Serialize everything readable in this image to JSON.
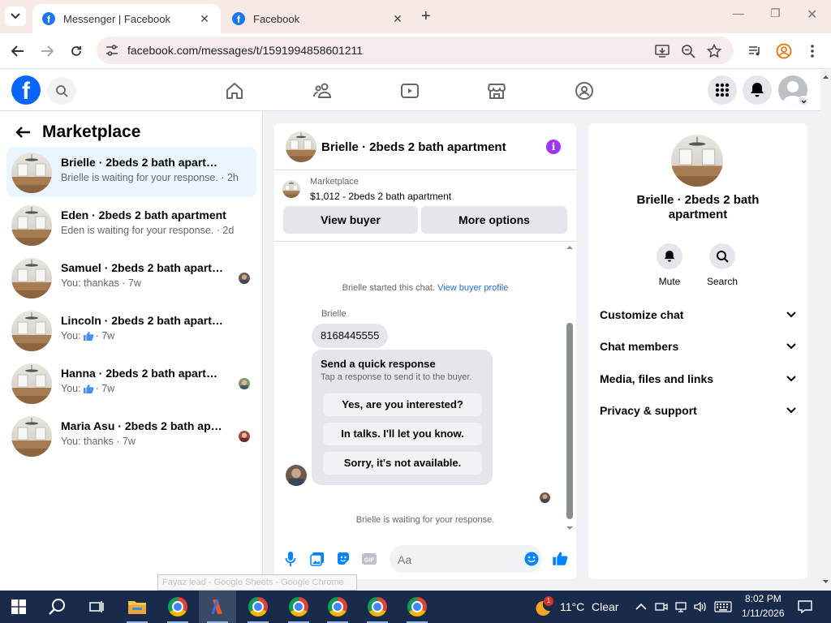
{
  "browser": {
    "tabs": [
      {
        "title": "Messenger | Facebook",
        "active": true
      },
      {
        "title": "Facebook",
        "active": false
      }
    ],
    "url": "facebook.com/messages/t/1591994858601211"
  },
  "marketplace": {
    "title": "Marketplace",
    "conversations": [
      {
        "name": "Brielle · 2beds 2 bath apartment",
        "snippet": "Brielle is waiting for your response. · 2h",
        "selected": true
      },
      {
        "name": "Eden · 2beds 2 bath apartment",
        "snippet": "Eden is waiting for your response. · 2d"
      },
      {
        "name": "Samuel · 2beds 2 bath apartment",
        "snippet": "You: thankas · 7w"
      },
      {
        "name": "Lincoln · 2beds 2 bath apartment",
        "snippet_prefix": "You:",
        "snippet_suffix": "· 7w"
      },
      {
        "name": "Hanna · 2beds 2 bath apartment",
        "snippet_prefix": "You:",
        "snippet_suffix": "· 7w"
      },
      {
        "name": "Maria Asu · 2beds 2 bath apart...",
        "snippet": "You: thanks · 7w"
      }
    ]
  },
  "chat": {
    "header_name": "Brielle · 2beds 2 bath apartment",
    "info_glyph": "i",
    "listing_label": "Marketplace",
    "listing_price": "$1,012 - 2beds 2 bath apartment",
    "view_buyer": "View buyer",
    "more_options": "More options",
    "started_text": "Brielle started this chat.",
    "view_profile_link": "View buyer profile",
    "sender": "Brielle",
    "message": "8168445555",
    "quick_title": "Send a quick response",
    "quick_subtitle": "Tap a response to send it to the buyer.",
    "quick_options": [
      "Yes, are you interested?",
      "In talks. I'll let you know.",
      "Sorry, it's not available."
    ],
    "waiting": "Brielle is waiting for your response.",
    "input_placeholder": "Aa"
  },
  "details": {
    "name": "Brielle · 2beds 2 bath apartment",
    "actions": [
      "Mute",
      "Search"
    ],
    "sections": [
      "Customize chat",
      "Chat members",
      "Media, files and links",
      "Privacy & support"
    ]
  },
  "tooltip": "Fayaz lead - Google Sheets - Google Chrome",
  "taskbar": {
    "weather_temp": "11°C",
    "weather_cond": "Clear",
    "weather_badge": "1",
    "time": "8:02 PM",
    "date": "1/11/2026"
  },
  "colors": {
    "brand": "#0866ff",
    "accent": "#0084ff",
    "info": "#a033ff"
  }
}
